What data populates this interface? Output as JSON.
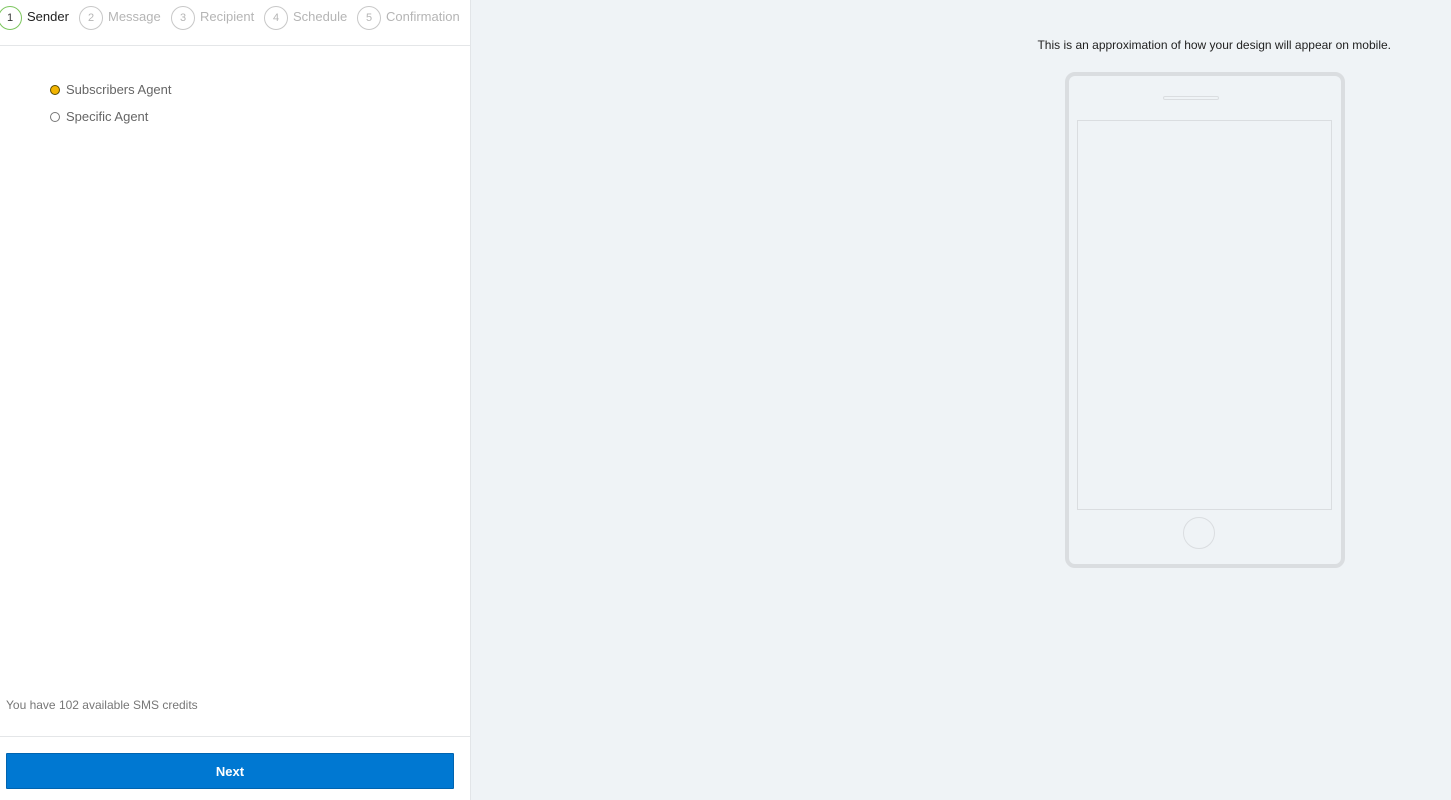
{
  "stepper": {
    "steps": [
      {
        "number": "1",
        "label": "Sender",
        "active": true
      },
      {
        "number": "2",
        "label": "Message",
        "active": false
      },
      {
        "number": "3",
        "label": "Recipient",
        "active": false
      },
      {
        "number": "4",
        "label": "Schedule",
        "active": false
      },
      {
        "number": "5",
        "label": "Confirmation",
        "active": false
      }
    ]
  },
  "sender": {
    "options": [
      {
        "label": "Subscribers Agent",
        "selected": true
      },
      {
        "label": "Specific Agent",
        "selected": false
      }
    ]
  },
  "footer": {
    "credits_text": "You have 102 available SMS credits",
    "next_label": "Next"
  },
  "preview": {
    "note": "This is an approximation of how your design will appear on mobile."
  },
  "colors": {
    "primary_button": "#0078d2",
    "active_step_ring": "#7cc65e",
    "selected_radio": "#f2b400",
    "preview_background": "#eff3f6"
  }
}
